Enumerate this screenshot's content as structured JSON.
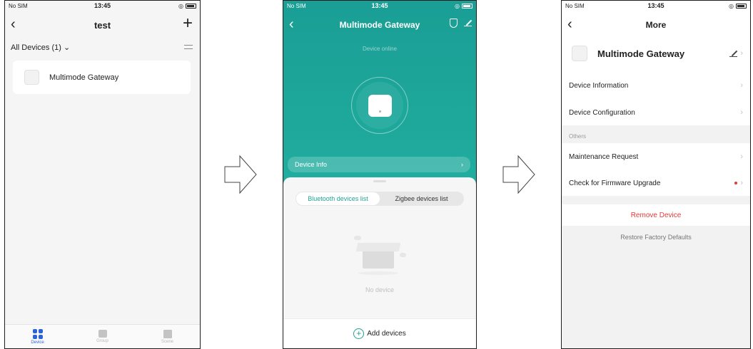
{
  "status_bar": {
    "carrier": "No SIM",
    "time": "13:45"
  },
  "screen1": {
    "title": "test",
    "filter_label": "All Devices (1)",
    "filter_chevron": "⌄",
    "add_icon": "+",
    "device_name": "Multimode Gateway",
    "tabs": [
      {
        "label": "Device",
        "icon": "grid-icon",
        "active": true
      },
      {
        "label": "Group",
        "icon": "group-icon",
        "active": false
      },
      {
        "label": "Scene",
        "icon": "scene-icon",
        "active": false
      }
    ]
  },
  "screen2": {
    "title": "Multimode Gateway",
    "status": "Device online",
    "device_info_label": "Device Info",
    "tabs": [
      "Bluetooth devices list",
      "Zigbee devices list"
    ],
    "selected_tab": "Bluetooth devices list",
    "empty_text": "No device",
    "add_button_label": "Add devices",
    "accent_color": "#1fa392"
  },
  "screen3": {
    "title": "More",
    "device_name": "Multimode Gateway",
    "rows": {
      "device_information": "Device Information",
      "device_configuration": "Device Configuration",
      "section_others": "Others",
      "maintenance_request": "Maintenance Request",
      "firmware_upgrade": "Check for Firmware Upgrade"
    },
    "remove_device": "Remove Device",
    "restore_factory": "Restore Factory Defaults",
    "danger_color": "#e53935"
  }
}
